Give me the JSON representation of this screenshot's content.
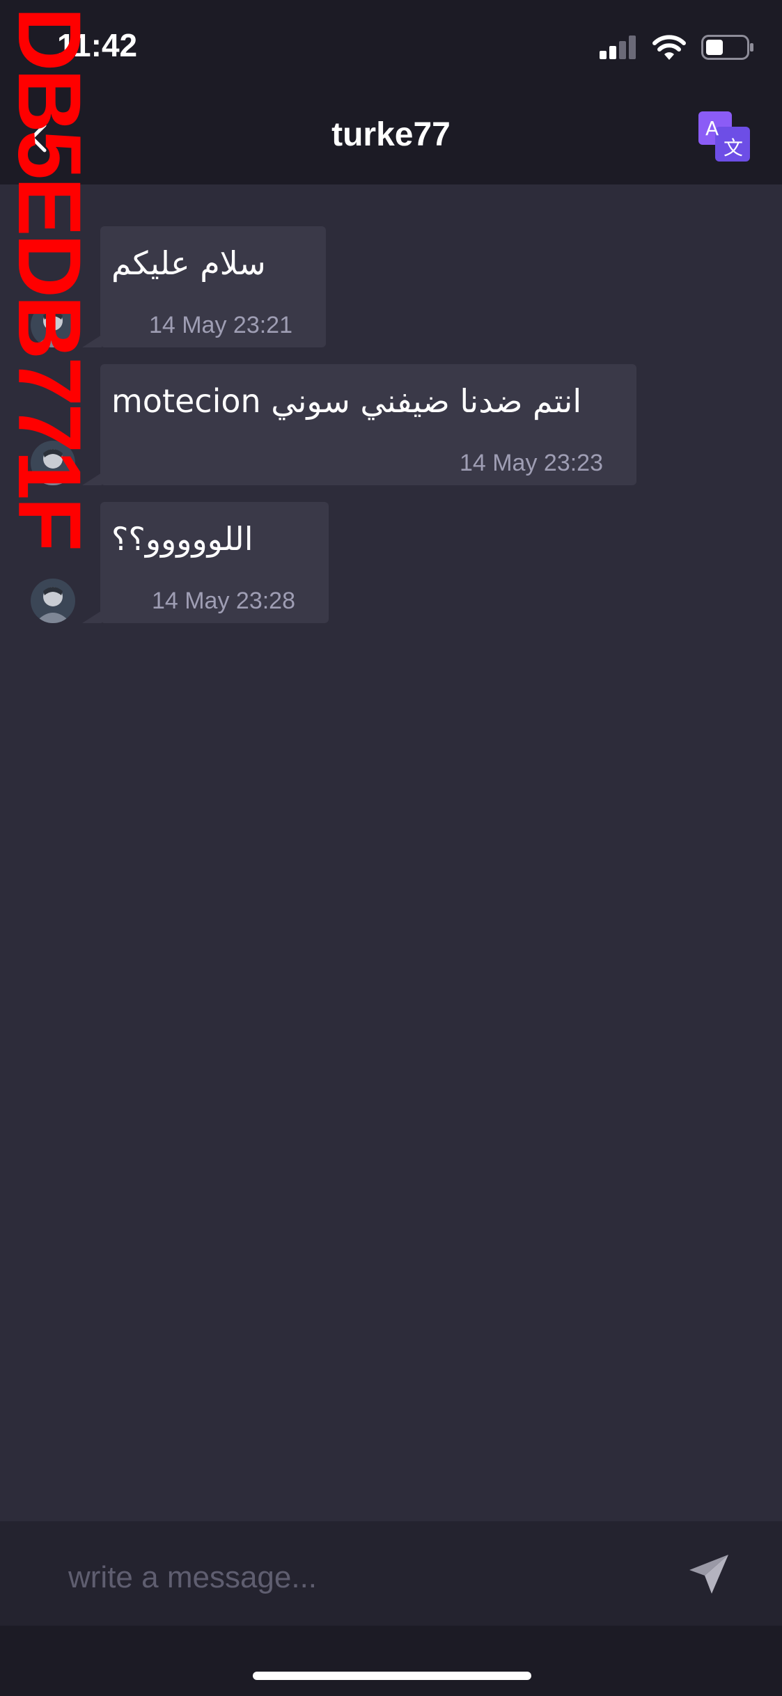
{
  "status_bar": {
    "time": "11:42",
    "icons": [
      "signal-icon",
      "wifi-icon",
      "battery-icon"
    ]
  },
  "nav": {
    "back_icon": "chevron-left-icon",
    "title": "turke77",
    "translate_icon": "translate-icon"
  },
  "messages": [
    {
      "text": "سلام عليكم",
      "time": "14 May 23:21"
    },
    {
      "text": "motecion انتم ضدنا ضيفني سوني",
      "time": "14 May 23:23"
    },
    {
      "text": "اللووووو؟؟",
      "time": "14 May 23:28"
    }
  ],
  "composer": {
    "placeholder": "write a message...",
    "send_icon": "send-icon"
  },
  "watermark": "DB5EDB771F",
  "colors": {
    "background": "#2d2c3a",
    "bar": "#1c1b25",
    "bubble": "#3a3948",
    "timestamp": "#9f9eb4",
    "translate_accent": "#8b5cf6"
  }
}
